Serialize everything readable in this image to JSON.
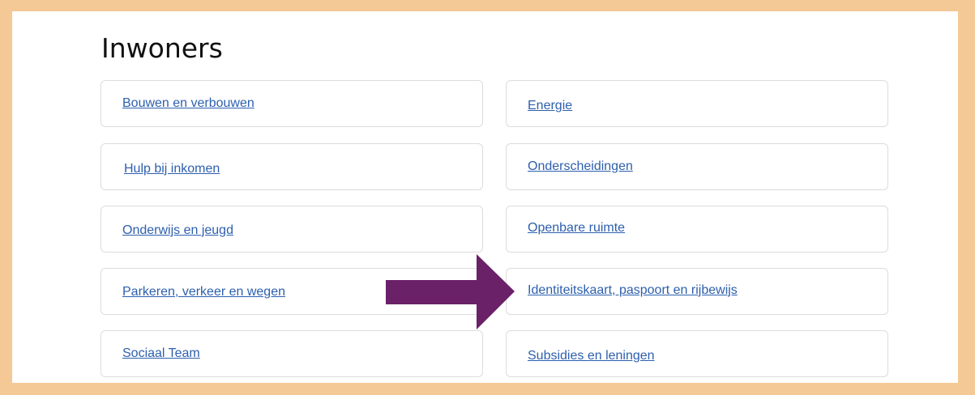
{
  "section": {
    "title": "Inwoners"
  },
  "colors": {
    "frame": "#f4c995",
    "link": "#2d5fae",
    "arrow": "#6a2168"
  },
  "left_links": [
    "Bouwen en verbouwen",
    "Hulp bij inkomen",
    "Onderwijs en jeugd",
    "Parkeren, verkeer en wegen",
    "Sociaal Team"
  ],
  "right_links": [
    "Energie",
    "Onderscheidingen",
    "Openbare ruimte",
    "Identiteitskaart, paspoort en rijbewijs",
    "Subsidies en leningen"
  ],
  "annotation": {
    "icon": "arrow-right-icon",
    "points_to": "Identiteitskaart, paspoort en rijbewijs"
  }
}
